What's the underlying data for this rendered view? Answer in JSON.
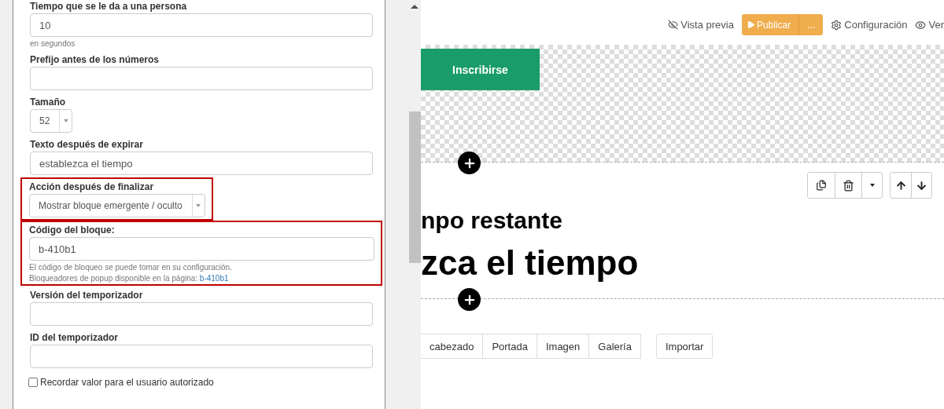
{
  "settings_panel": {
    "fields": [
      {
        "kind": "text",
        "label": "Tiempo que se le da a una persona",
        "value": "10",
        "hints": [
          {
            "text": "en segundos"
          }
        ],
        "highlighted": false
      },
      {
        "kind": "text",
        "label": "Prefijo antes de los números",
        "highlighted": false
      },
      {
        "kind": "select",
        "label": "Tamaño",
        "value": "52",
        "highlighted": false
      },
      {
        "kind": "text",
        "label": "Texto después de expirar",
        "value": "establezca el tiempo",
        "highlighted": false
      },
      {
        "kind": "select",
        "label": "Acción después de finalizar",
        "value": "Mostrar bloque emergente / oculto",
        "highlighted": true
      },
      {
        "kind": "text",
        "label": "Código del bloque:",
        "value": "b-410b1",
        "hints": [
          {
            "text": "El código de bloqueo se puede tomar en su configuración."
          },
          {
            "text": "Bloqueadores de popup disponible en la página:",
            "link": "b-410b1"
          }
        ],
        "highlighted": true
      },
      {
        "kind": "text",
        "label": "Versión del temporizador",
        "highlighted": false
      },
      {
        "kind": "text",
        "label": "ID del temporizador",
        "highlighted": false
      },
      {
        "kind": "checkbox",
        "label": "Recordar valor para el usuario autorizado",
        "checked": false
      }
    ]
  },
  "top_bar": {
    "preview": "Vista previa",
    "publish": "Publicar",
    "publish_more": "...",
    "settings": "Configuración",
    "view": "Ver"
  },
  "canvas": {
    "signup_button": "Inscribirse",
    "heading": "npo restante",
    "countdown_text": "zca el tiempo",
    "block_types": [
      "cabezado",
      "Portada",
      "Imagen",
      "Galería"
    ],
    "import_button": "Importar"
  }
}
